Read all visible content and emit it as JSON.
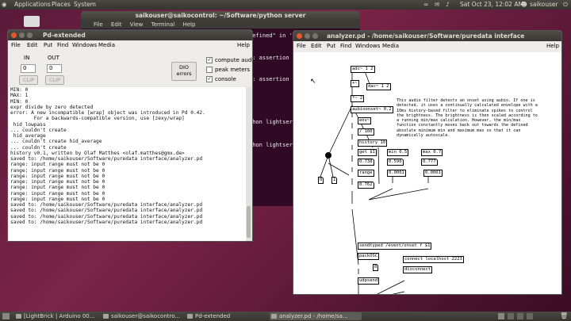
{
  "top_panel": {
    "menus": [
      "Applications",
      "Places",
      "System"
    ],
    "clock": "Sat Oct 23, 12:02 AM",
    "user": "saikouser"
  },
  "terminal": {
    "title": "saikouser@saikocontrol: ~/Software/python server",
    "menu": [
      "File",
      "Edit",
      "View",
      "Terminal",
      "Help"
    ],
    "lines": [
      "defined\" in 'liblo.",
      "x: assertion",
      "x: assertion",
      "thon lightser",
      "thon lightser"
    ]
  },
  "pd_extended": {
    "title": "Pd-extended",
    "menu": [
      "File",
      "Edit",
      "Put",
      "Find",
      "Windows",
      "Media"
    ],
    "help": "Help",
    "in_label": "IN",
    "out_label": "OUT",
    "in_value": "0",
    "out_value": "0",
    "clip_label": "CLIP",
    "dio_label": "DIO\nerrors",
    "checkboxes": [
      {
        "label": "compute audio",
        "checked": true
      },
      {
        "label": "peak meters",
        "checked": false
      },
      {
        "label": "console",
        "checked": true
      }
    ],
    "console_lines": [
      "MIN: 0",
      "MAX: 1",
      "MIN: 0",
      "expr divide by zero detected",
      "error: A new incompatible [wrap] object was introduced in Pd 0.42.",
      "        For a backwards-compatible version, use [zexy/wrap]",
      " hid_lowpass",
      "... couldn't create",
      " hid_average",
      "... couldn't create hid_average",
      "... couldn't create",
      "history v0.1, written by Olaf Matthes <olaf.matthes@gmx.de>",
      "saved to: /home/saikouser/Software/puredata interface/analyzer.pd",
      "range: input range must not be 0",
      "range: input range must not be 0",
      "range: input range must not be 0",
      "range: input range must not be 0",
      "range: input range must not be 0",
      "range: input range must not be 0",
      "range: input range must not be 0",
      "saved to: /home/saikouser/Software/puredata interface/analyzer.pd",
      "saved to: /home/saikouser/Software/puredata interface/analyzer.pd",
      "saved to: /home/saikouser/Software/puredata interface/analyzer.pd",
      "saved to: /home/saikouser/Software/puredata interface/analyzer.pd"
    ]
  },
  "analyzer": {
    "title": "analyzer.pd  - /home/saikouser/Software/puredata interface",
    "menu": [
      "File",
      "Edit",
      "Put",
      "Find",
      "Windows",
      "Media"
    ],
    "help": "Help",
    "objects": {
      "adc": "adc~ 1 2",
      "plus": "+~",
      "dac": "dac~ 1 2",
      "times": "*~ 2",
      "aubio": "aubioonset~ 0.2",
      "env": "env~",
      "div": "/ 100",
      "history": "history 10",
      "get": "get $1",
      "min": "min 0.5",
      "max": "max 0.7",
      "num1": "0.738",
      "num2": "0.590",
      "num3": "0.777",
      "range": "range",
      "zero1": "0.0001",
      "zero2": "0.0001",
      "num4": "0.762",
      "zero_a": "0",
      "one_a": "1",
      "sendtyped": "sendtyped /event/onset f $1",
      "packosc": "packOSC",
      "connect": "connect localhost 2223",
      "disconnect": "disconnect",
      "udpsend": "udpsend",
      "udp_num": "0"
    },
    "comment": "This audio filter detects an onset using aubio. If one is\ndetected, it uses a continually calculated envelope with a\n10ms history-based filter to eliminate spikes to control\nthe brightness. The brightness is then scaled according to\na running min/max calculation. However, the min/max\nfunction constantly moves back out towards the defined\nabsolute minimum min and maximum max so that it can\ndynamically autoscale."
  },
  "taskbar": [
    {
      "label": "[LightBrick | Arduino 00...",
      "active": false
    },
    {
      "label": "saikouser@saikocontro...",
      "active": false
    },
    {
      "label": "Pd-extended",
      "active": false
    },
    {
      "label": "analyzer.pd - /home/sa...",
      "active": true
    }
  ]
}
